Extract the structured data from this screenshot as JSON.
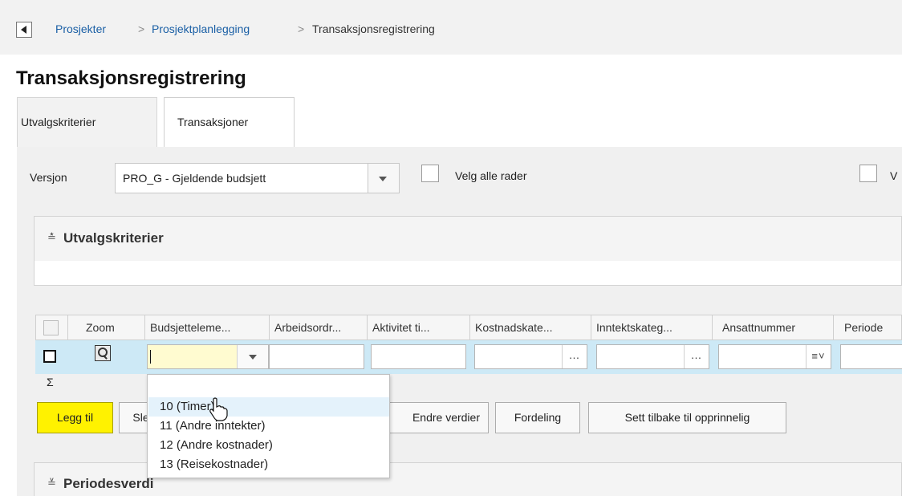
{
  "breadcrumb": {
    "items": [
      "Prosjekter",
      "Prosjektplanlegging",
      "Transaksjonsregistrering"
    ],
    "separator": ">"
  },
  "page": {
    "title": "Transaksjonsregistrering"
  },
  "tabs": [
    {
      "label": "Utvalgskriterier",
      "active": false
    },
    {
      "label": "Transaksjoner",
      "active": true
    }
  ],
  "version": {
    "label": "Versjon",
    "value": "PRO_G - Gjeldende budsjett"
  },
  "select_all": {
    "label": "Velg alle rader",
    "checked": false
  },
  "extra_checkbox": {
    "label": "V",
    "checked": false
  },
  "criteria_section": {
    "title": "Utvalgskriterier",
    "collapse_icon": "double-chevron-down-icon"
  },
  "grid": {
    "columns": [
      "",
      "Zoom",
      "Budsjetteleme...",
      "Arbeidsordr...",
      "Aktivitet ti...",
      "Kostnadskate...",
      "Inntektskateg...",
      "Ansattnummer",
      "Periode"
    ],
    "row": {
      "budget_element_value": "",
      "sum_symbol": "Σ"
    }
  },
  "buttons": {
    "add": "Legg til",
    "delete": "Sle",
    "change_values": "Endre verdier",
    "distribution": "Fordeling",
    "reset": "Sett tilbake til opprinnelig"
  },
  "period_section": {
    "title": "Periodesverdi",
    "collapse_icon": "double-chevron-up-icon"
  },
  "dropdown": {
    "options": [
      "10 (Timer)",
      "11 (Andre inntekter)",
      "12 (Andre kostnader)",
      "13 (Reisekostnader)"
    ],
    "highlighted_index": 0
  },
  "colors": {
    "link": "#1a5fa5",
    "primary_button": "#fff200",
    "row_highlight": "#cde9f6"
  }
}
